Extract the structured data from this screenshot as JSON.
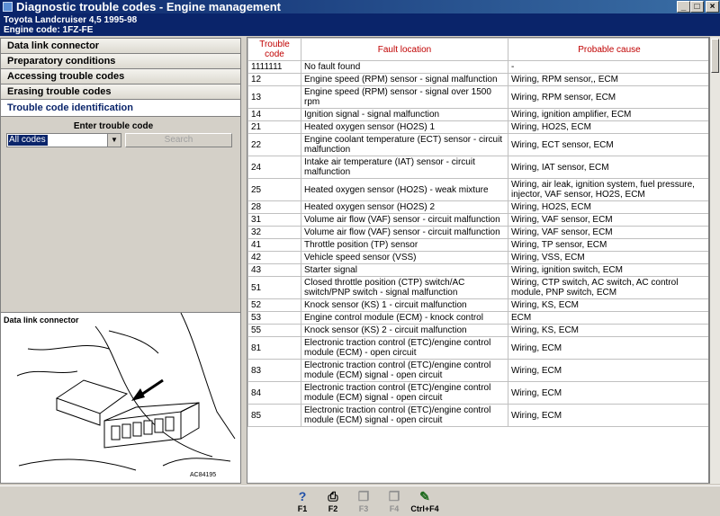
{
  "window": {
    "title": "Diagnostic trouble codes - Engine management"
  },
  "info": {
    "vehicle": "Toyota  Landcruiser 4,5  1995-98",
    "engine": "Engine code: 1FZ-FE"
  },
  "nav": {
    "items": [
      {
        "label": "Data link connector"
      },
      {
        "label": "Preparatory conditions"
      },
      {
        "label": "Accessing trouble codes"
      },
      {
        "label": "Erasing trouble codes"
      },
      {
        "label": "Trouble code identification"
      }
    ]
  },
  "entry": {
    "label": "Enter trouble code",
    "select_value": "All codes",
    "search_label": "Search"
  },
  "diagram": {
    "caption": "Data link connector",
    "ref": "AC84195"
  },
  "table": {
    "headers": {
      "code": "Trouble code",
      "location": "Fault location",
      "cause": "Probable cause"
    },
    "rows": [
      {
        "code": "1111111",
        "location": "No fault found",
        "cause": "-"
      },
      {
        "code": "12",
        "location": "Engine speed (RPM) sensor - signal malfunction",
        "cause": "Wiring, RPM sensor,, ECM"
      },
      {
        "code": "13",
        "location": "Engine speed (RPM) sensor - signal over 1500 rpm",
        "cause": "Wiring, RPM sensor, ECM"
      },
      {
        "code": "14",
        "location": "Ignition signal - signal malfunction",
        "cause": "Wiring, ignition amplifier, ECM"
      },
      {
        "code": "21",
        "location": "Heated oxygen sensor (HO2S) 1",
        "cause": "Wiring, HO2S, ECM"
      },
      {
        "code": "22",
        "location": "Engine coolant temperature (ECT) sensor - circuit malfunction",
        "cause": "Wiring, ECT sensor, ECM"
      },
      {
        "code": "24",
        "location": "Intake air temperature (IAT) sensor - circuit malfunction",
        "cause": "Wiring, IAT sensor, ECM"
      },
      {
        "code": "25",
        "location": "Heated oxygen sensor (HO2S) - weak mixture",
        "cause": "Wiring, air leak, ignition system, fuel pressure, injector, VAF sensor, HO2S, ECM"
      },
      {
        "code": "28",
        "location": "Heated oxygen sensor (HO2S) 2",
        "cause": "Wiring, HO2S, ECM"
      },
      {
        "code": "31",
        "location": "Volume air flow (VAF) sensor - circuit malfunction",
        "cause": "Wiring, VAF sensor, ECM"
      },
      {
        "code": "32",
        "location": "Volume air flow (VAF) sensor - circuit malfunction",
        "cause": "Wiring, VAF sensor, ECM"
      },
      {
        "code": "41",
        "location": "Throttle position (TP) sensor",
        "cause": "Wiring, TP sensor, ECM"
      },
      {
        "code": "42",
        "location": "Vehicle speed sensor (VSS)",
        "cause": "Wiring, VSS, ECM"
      },
      {
        "code": "43",
        "location": "Starter signal",
        "cause": "Wiring, ignition switch, ECM"
      },
      {
        "code": "51",
        "location": "Closed throttle position (CTP) switch/AC switch/PNP switch - signal malfunction",
        "cause": "Wiring, CTP switch, AC switch, AC control module, PNP switch, ECM"
      },
      {
        "code": "52",
        "location": "Knock sensor (KS) 1 - circuit malfunction",
        "cause": "Wiring, KS, ECM"
      },
      {
        "code": "53",
        "location": "Engine control module (ECM) - knock control",
        "cause": "ECM"
      },
      {
        "code": "55",
        "location": "Knock sensor (KS) 2 - circuit malfunction",
        "cause": "Wiring, KS, ECM"
      },
      {
        "code": "81",
        "location": "Electronic traction control (ETC)/engine control module (ECM) - open circuit",
        "cause": "Wiring, ECM"
      },
      {
        "code": "83",
        "location": "Electronic traction control (ETC)/engine control module (ECM) signal - open circuit",
        "cause": "Wiring, ECM"
      },
      {
        "code": "84",
        "location": "Electronic traction control (ETC)/engine control module (ECM) signal - open circuit",
        "cause": "Wiring, ECM"
      },
      {
        "code": "85",
        "location": "Electronic traction control (ETC)/engine control module (ECM) signal - open circuit",
        "cause": "Wiring, ECM"
      }
    ]
  },
  "fkeys": [
    {
      "label": "F1",
      "icon": "help-icon",
      "enabled": true
    },
    {
      "label": "F2",
      "icon": "printer-icon",
      "enabled": true
    },
    {
      "label": "F3",
      "icon": "copy-icon",
      "enabled": false
    },
    {
      "label": "F4",
      "icon": "copy-icon",
      "enabled": false
    },
    {
      "label": "Ctrl+F4",
      "icon": "notes-icon",
      "enabled": true
    }
  ]
}
